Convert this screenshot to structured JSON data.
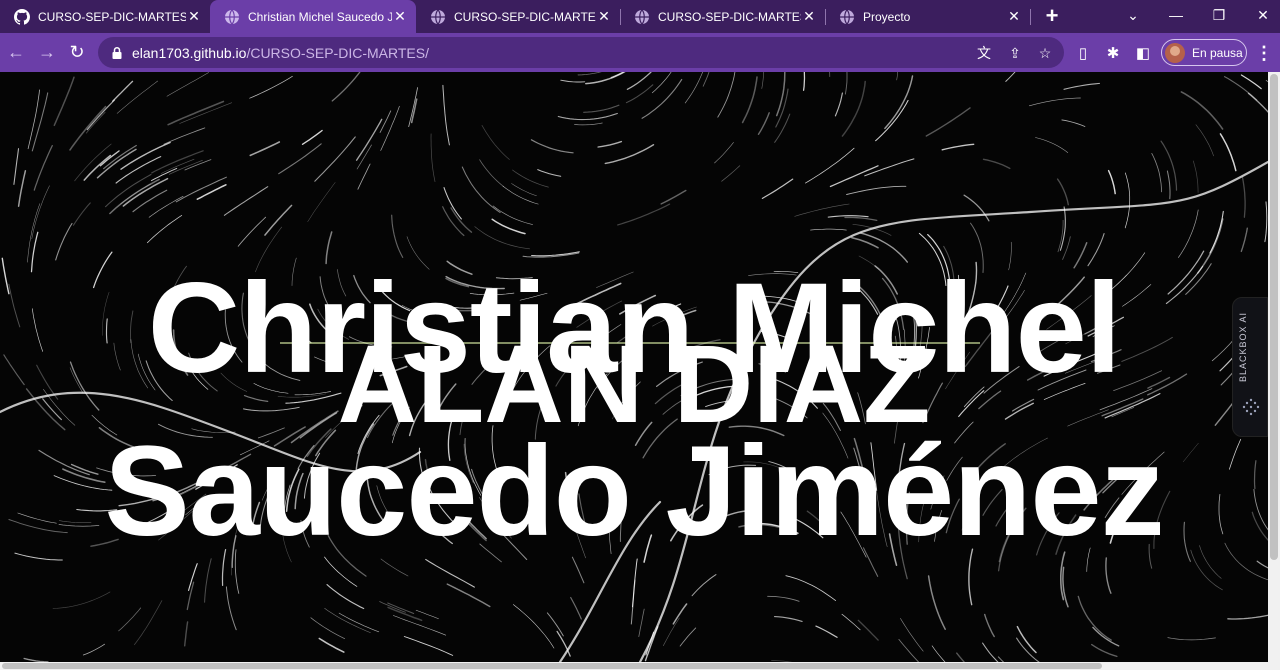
{
  "browser": {
    "tabs": [
      {
        "title": "CURSO-SEP-DIC-MARTES/in",
        "favicon": "github-icon",
        "active": false
      },
      {
        "title": "Christian Michel Saucedo Jim",
        "favicon": "globe-icon",
        "active": true
      },
      {
        "title": "CURSO-SEP-DIC-MARTES | A",
        "favicon": "globe-icon",
        "active": false
      },
      {
        "title": "CURSO-SEP-DIC-MARTES | A",
        "favicon": "globe-icon",
        "active": false
      },
      {
        "title": "Proyecto",
        "favicon": "globe-icon",
        "active": false
      }
    ],
    "url_host": "elan1703.github.io",
    "url_path": "/CURSO-SEP-DIC-MARTES/",
    "profile_label": "En pausa",
    "colors": {
      "tabstrip": "#3b1e5e",
      "toolbar": "#6b3ea8",
      "omnibox": "#4e2a7f"
    }
  },
  "page": {
    "name_line1": "Christian Michel",
    "name_line2": "Saucedo Jiménez",
    "behind_text": "ALAN DIAZ",
    "sidepanel_label": "BLACKBOX AI"
  }
}
